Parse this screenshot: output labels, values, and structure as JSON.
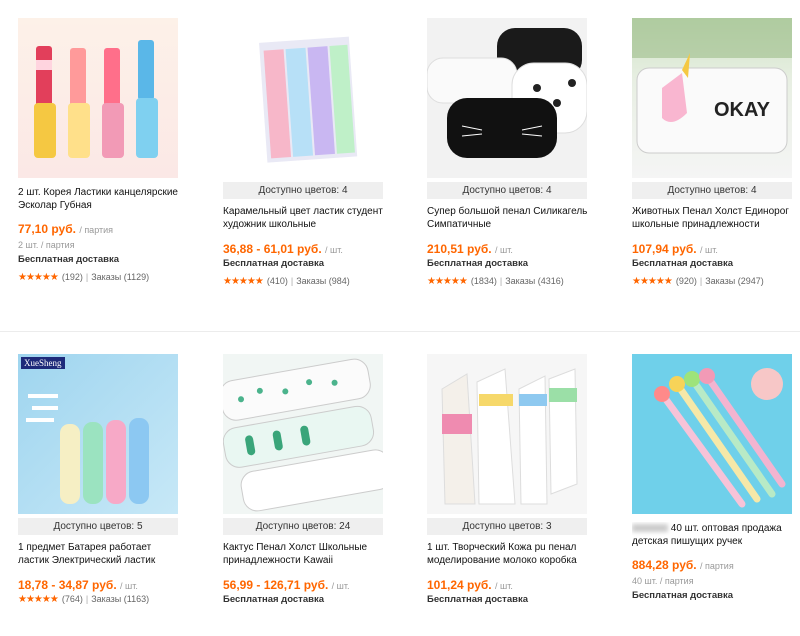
{
  "products": [
    {
      "colors": "",
      "title": "2 шт. Корея Ластики канцелярские Эсколар Губная",
      "price": "77,10 руб.",
      "price_unit": "/ партия",
      "sub": "2 шт. / партия",
      "shipping": "Бесплатная доставка",
      "reviews": "(192)",
      "orders": "Заказы (1129)"
    },
    {
      "colors": "Доступно цветов: 4",
      "title": "Карамельный цвет ластик студент художник школьные",
      "price": "36,88 - 61,01 руб.",
      "price_unit": "/ шт.",
      "sub": "",
      "shipping": "Бесплатная доставка",
      "reviews": "(410)",
      "orders": "Заказы (984)"
    },
    {
      "colors": "Доступно цветов: 4",
      "title": "Супер большой пенал Силикагель Симпатичные",
      "price": "210,51 руб.",
      "price_unit": "/ шт.",
      "sub": "",
      "shipping": "Бесплатная доставка",
      "reviews": "(1834)",
      "orders": "Заказы (4316)"
    },
    {
      "colors": "Доступно цветов: 4",
      "title": "Животных Пенал Холст Единорог школьные принадлежности",
      "price": "107,94 руб.",
      "price_unit": "/ шт.",
      "sub": "",
      "shipping": "Бесплатная доставка",
      "reviews": "(920)",
      "orders": "Заказы (2947)"
    },
    {
      "colors": "Доступно цветов: 5",
      "brand": "XueSheng",
      "title": "1 предмет Батарея работает ластик Электрический ластик",
      "price": "18,78 - 34,87 руб.",
      "price_unit": "/ шт.",
      "sub": "",
      "shipping": "",
      "reviews": "(764)",
      "orders": "Заказы (1163)"
    },
    {
      "colors": "Доступно цветов: 24",
      "title": "Кактус Пенал Холст Школьные принадлежности Kawaii",
      "price": "56,99 - 126,71 руб.",
      "price_unit": "/ шт.",
      "sub": "",
      "shipping": "Бесплатная доставка",
      "reviews": "",
      "orders": ""
    },
    {
      "colors": "Доступно цветов: 3",
      "title": "1 шт. Творческий Кожа pu пенал моделирование молоко коробка",
      "price": "101,24 руб.",
      "price_unit": "/ шт.",
      "sub": "",
      "shipping": "Бесплатная доставка",
      "reviews": "",
      "orders": ""
    },
    {
      "colors": "",
      "title": "40 шт. оптовая продажа детская пишущих ручек",
      "price": "884,28 руб.",
      "price_unit": "/ партия",
      "sub": "40 шт. / партия",
      "shipping": "Бесплатная доставка",
      "reviews": "",
      "orders": ""
    }
  ],
  "stars": "★★★★★",
  "separator": "|"
}
